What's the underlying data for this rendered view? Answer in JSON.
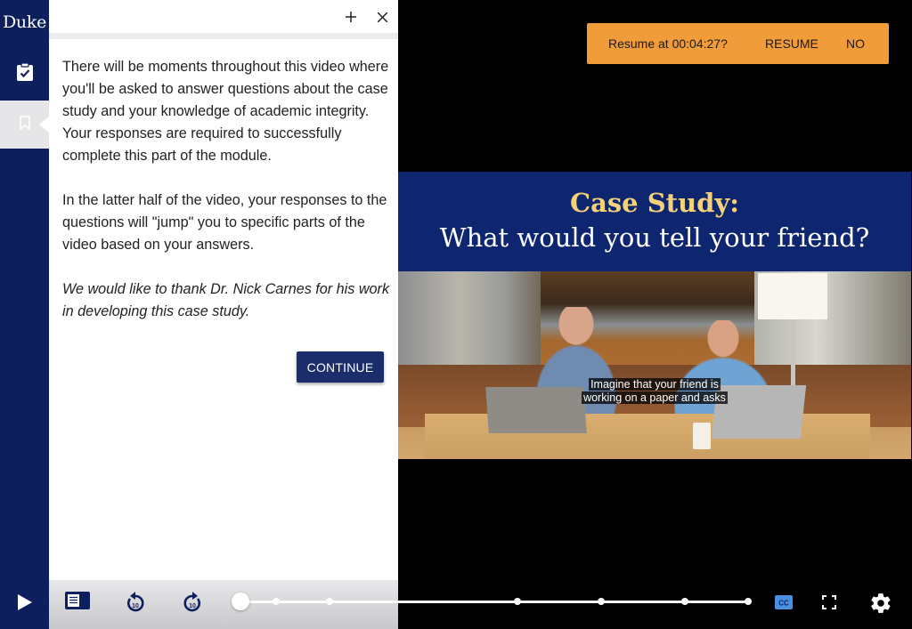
{
  "brand": {
    "name": "Duke"
  },
  "rail": {
    "items": [
      {
        "icon": "clipboard-check-icon",
        "active": false
      },
      {
        "icon": "bookmark-icon",
        "active": true
      }
    ]
  },
  "panel": {
    "header_icons": [
      "plus-icon",
      "close-icon"
    ],
    "paragraphs": [
      "There will be moments throughout this video where you'll be asked to answer questions about the case study and your knowledge of academic integrity. Your responses are required to successfully complete this part of the module.",
      "In the latter half of the video, your responses to the questions will \"jump\" you to specific parts of the video based on your answers."
    ],
    "acknowledgement": "We would like to thank Dr. Nick Carnes for his work in developing this case study.",
    "continue_label": "CONTINUE"
  },
  "resume_prompt": {
    "text": "Resume at 00:04:27?",
    "resume_label": "RESUME",
    "no_label": "NO",
    "color": "#f09c3a"
  },
  "video": {
    "title_line1": "Case Study:",
    "title_line2": "What would you tell your friend?",
    "caption_line1": "Imagine that your friend is",
    "caption_line2": "working on a paper and asks",
    "title_band_color": "#0e2570",
    "title_accent_color": "#f4d27a"
  },
  "controls": {
    "play_icon": "play-icon",
    "transcript_icon": "transcript-icon",
    "rewind_label": "10",
    "forward_label": "10",
    "cc_label": "CC",
    "cc_active": true,
    "fullscreen_icon": "fullscreen-icon",
    "settings_icon": "gear-icon",
    "progress_fraction": 0.0,
    "chapter_markers": [
      0.07,
      0.175,
      0.545,
      0.71,
      0.875,
      1.0
    ],
    "accent_color": "#0d1f5c"
  }
}
